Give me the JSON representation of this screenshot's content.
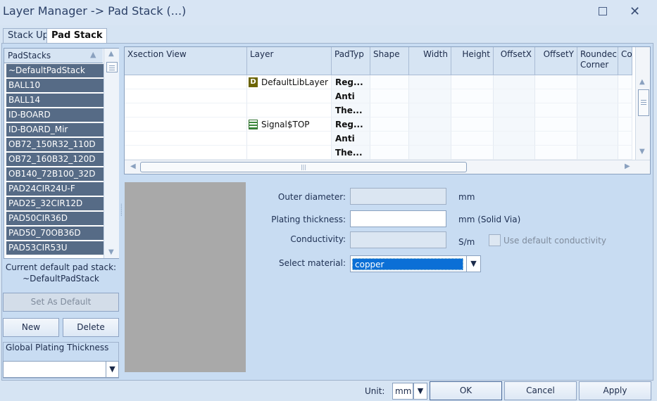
{
  "window": {
    "title": "Layer Manager -> Pad Stack (...)"
  },
  "tabs": [
    {
      "label": "Stack Up",
      "active": false
    },
    {
      "label": "Pad Stack",
      "active": true
    }
  ],
  "padstacks": {
    "header": "PadStacks",
    "items": [
      "~DefaultPadStack",
      "BALL10",
      "BALL14",
      "ID-BOARD",
      "ID-BOARD_Mir",
      "OB72_150R32_110D",
      "OB72_160B32_120D",
      "OB140_72B100_32D",
      "PAD24CIR24U-F",
      "PAD25_32CIR12D",
      "PAD50CIR36D",
      "PAD50_70OB36D",
      "PAD53CIR53U"
    ],
    "current_label_line1": "Current default pad stack:",
    "current_label_line2": "~DefaultPadStack",
    "set_default_label": "Set As Default",
    "new_label": "New",
    "delete_label": "Delete",
    "global_plating_label": "Global Plating Thickness",
    "global_plating_value": ""
  },
  "grid": {
    "columns": [
      "Xsection View",
      "Layer",
      "PadTyp",
      "Shape",
      "Width",
      "Height",
      "OffsetX",
      "OffsetY",
      "Roundec Corner",
      "Co"
    ],
    "rows": [
      {
        "layer": "DefaultLibLayer",
        "layer_icon": "D",
        "padtype": "Reg..."
      },
      {
        "layer": "",
        "padtype": "Anti"
      },
      {
        "layer": "",
        "padtype": "The..."
      },
      {
        "layer": "Signal$TOP",
        "layer_icon": "signal-layer-icon",
        "padtype": "Reg..."
      },
      {
        "layer": "",
        "padtype": "Anti"
      },
      {
        "layer": "",
        "padtype": "The..."
      }
    ],
    "hscroll_thumb": "|||"
  },
  "form": {
    "outer_diameter_label": "Outer diameter:",
    "outer_diameter_value": "",
    "outer_diameter_unit": "mm",
    "plating_label": "Plating thickness:",
    "plating_value": "",
    "plating_unit": "mm (Solid Via)",
    "conductivity_label": "Conductivity:",
    "conductivity_value": "",
    "conductivity_unit": "S/m",
    "use_default_label": "Use default conductivity",
    "use_default_checked": false,
    "material_label": "Select material:",
    "material_value": "copper"
  },
  "bottom": {
    "unit_label": "Unit:",
    "unit_value": "mm",
    "ok_label": "OK",
    "cancel_label": "Cancel",
    "apply_label": "Apply"
  }
}
